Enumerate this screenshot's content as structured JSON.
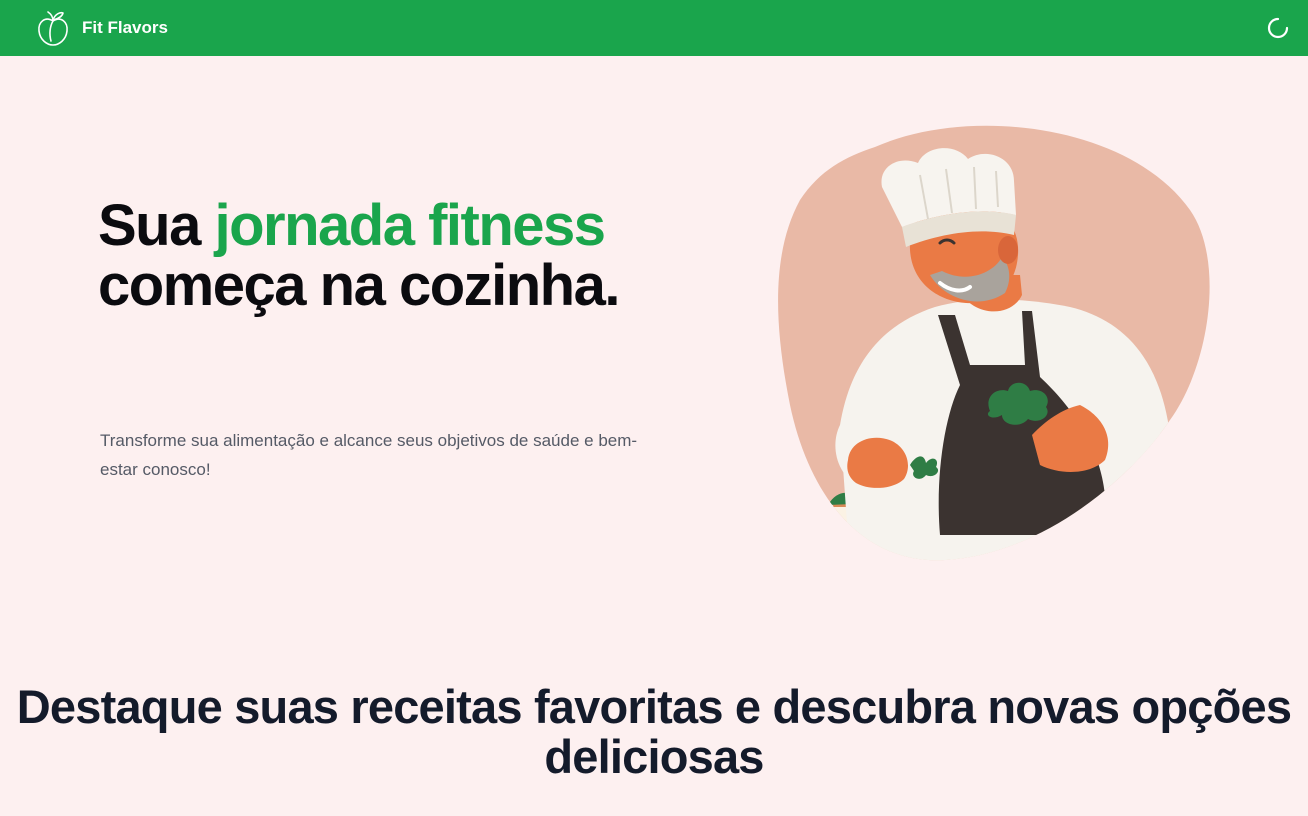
{
  "navbar": {
    "brand_name": "Fit Flavors",
    "logo_icon": "peach-icon",
    "loading_icon": "spinner-icon",
    "background_color": "#1aa54c"
  },
  "hero": {
    "title_part1": "Sua ",
    "title_accent": "jornada fitness",
    "title_part2": " começa na cozinha.",
    "subtitle": "Transforme sua alimentação e alcance seus objetivos de saúde e bem-estar conosco!",
    "accent_color": "#1aa54c",
    "illustration": "chef-garnishing-plate-illustration"
  },
  "section": {
    "title": "Destaque suas receitas favoritas e descubra novas opções deliciosas"
  },
  "colors": {
    "page_background": "#fdf0f0",
    "heading": "#0b0b0f",
    "blob": "#e9b9a6"
  }
}
